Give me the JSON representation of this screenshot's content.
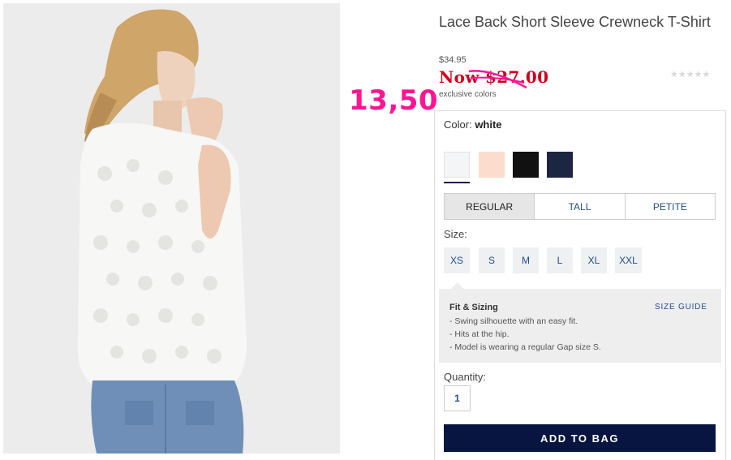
{
  "product": {
    "title": "Lace Back Short Sleeve Crewneck T-Shirt",
    "original_price": "$34.95",
    "sale_price": "Now $27.00",
    "handwritten_price": "13,50",
    "rating_stars": "★★★★★",
    "exclusive_label": "exclusive colors"
  },
  "color": {
    "label": "Color:",
    "selected": "white",
    "swatches": [
      {
        "name": "white",
        "hex": "#f4f5f6"
      },
      {
        "name": "pink",
        "hex": "#fcdccd"
      },
      {
        "name": "black",
        "hex": "#111111"
      },
      {
        "name": "navy",
        "hex": "#1c2541"
      }
    ]
  },
  "fit_tabs": [
    "REGULAR",
    "TALL",
    "PETITE"
  ],
  "size": {
    "label": "Size:",
    "options": [
      "XS",
      "S",
      "M",
      "L",
      "XL",
      "XXL"
    ]
  },
  "fit_sizing": {
    "title": "Fit & Sizing",
    "guide_link": "SIZE GUIDE",
    "lines": [
      "- Swing silhouette with an easy fit.",
      "- Hits at the hip.",
      "- Model is wearing a regular Gap size S."
    ]
  },
  "quantity": {
    "label": "Quantity:",
    "value": "1"
  },
  "add_to_bag": "ADD TO BAG",
  "colors": {
    "sale_red": "#d0021b",
    "scribble_pink": "#ff1493",
    "navy": "#081540",
    "link_blue": "#1f4e8c"
  }
}
